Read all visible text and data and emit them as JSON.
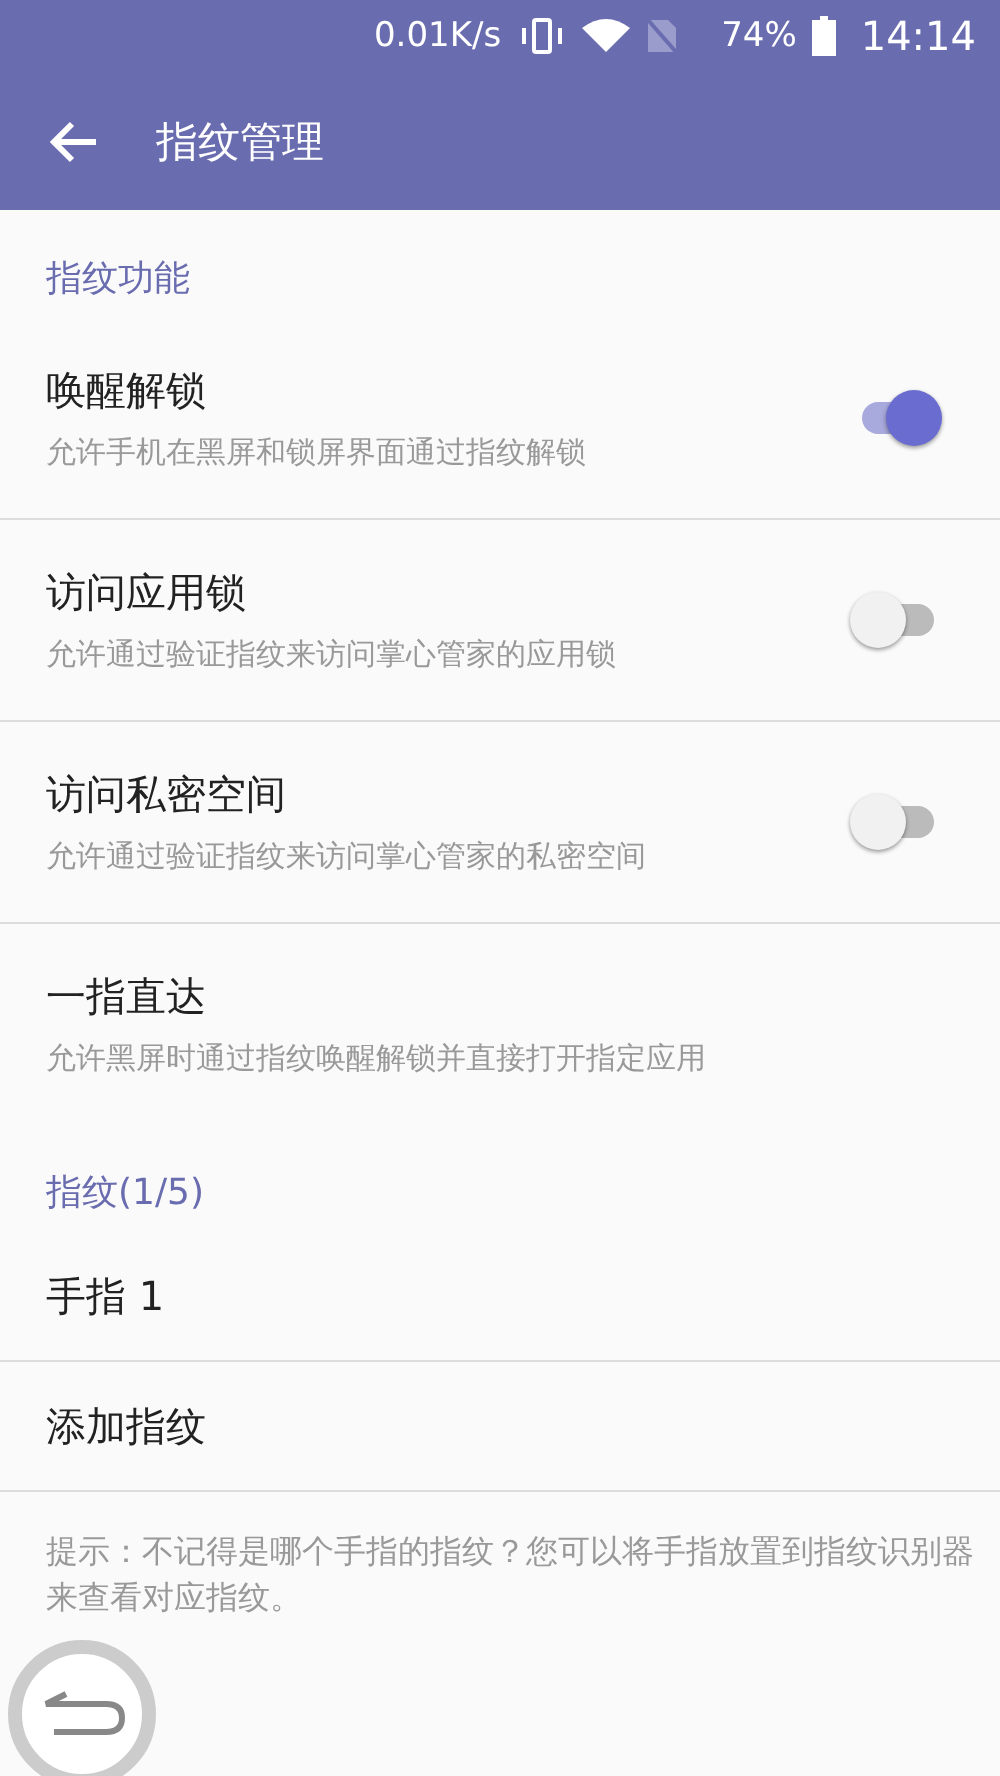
{
  "status_bar": {
    "speed": "0.01K/s",
    "battery_percent": "74%",
    "time": "14:14"
  },
  "app_bar": {
    "title": "指纹管理"
  },
  "sections": [
    {
      "header": "指纹功能",
      "items": [
        {
          "kind": "toggle",
          "title": "唤醒解锁",
          "subtitle": "允许手机在黑屏和锁屏界面通过指纹解锁",
          "on": true
        },
        {
          "kind": "toggle",
          "title": "访问应用锁",
          "subtitle": "允许通过验证指纹来访问掌心管家的应用锁",
          "on": false
        },
        {
          "kind": "toggle",
          "title": "访问私密空间",
          "subtitle": "允许通过验证指纹来访问掌心管家的私密空间",
          "on": false
        },
        {
          "kind": "link",
          "title": "一指直达",
          "subtitle": "允许黑屏时通过指纹唤醒解锁并直接打开指定应用"
        }
      ]
    },
    {
      "header": "指纹(1/5)",
      "items": [
        {
          "kind": "link",
          "title": "手指 1"
        },
        {
          "kind": "link",
          "title": "添加指纹"
        }
      ]
    }
  ],
  "hint": "提示：不记得是哪个手指的指纹？您可以将手指放置到指纹识别器来查看对应指纹。"
}
